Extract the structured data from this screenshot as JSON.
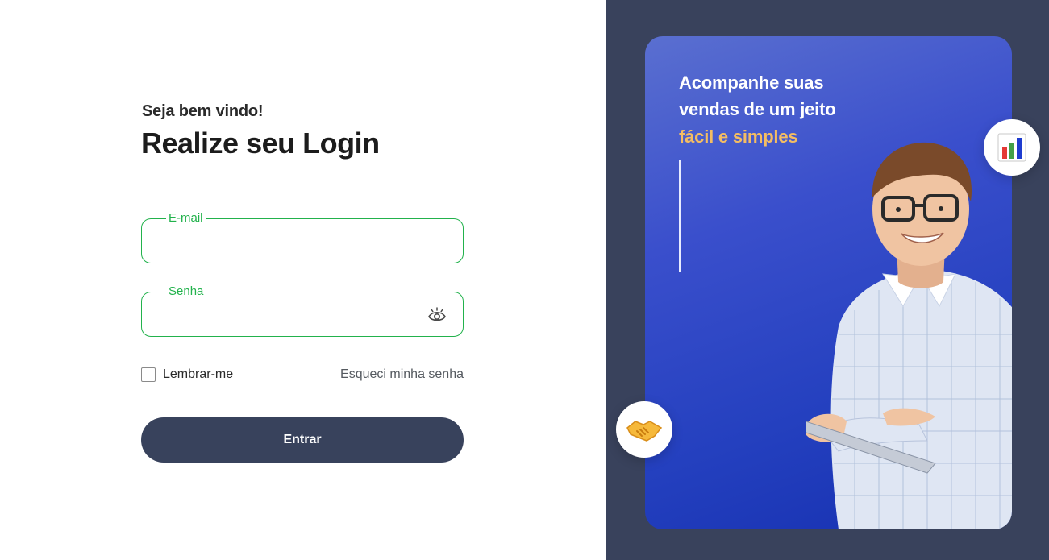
{
  "login": {
    "greeting": "Seja bem vindo!",
    "title": "Realize seu Login",
    "email": {
      "label": "E-mail",
      "value": ""
    },
    "password": {
      "label": "Senha",
      "value": ""
    },
    "remember_label": "Lembrar-me",
    "forgot_label": "Esqueci minha senha",
    "submit_label": "Entrar"
  },
  "promo": {
    "line1": "Acompanhe suas",
    "line2": "vendas de um jeito",
    "line3": "fácil e simples"
  },
  "colors": {
    "accent_green": "#22b24c",
    "dark_navy": "#38425c",
    "promo_blue": "#2440bf",
    "highlight_orange": "#f4bd63"
  },
  "icons": [
    "eye-icon",
    "bar-chart-icon",
    "handshake-icon",
    "checkbox"
  ]
}
